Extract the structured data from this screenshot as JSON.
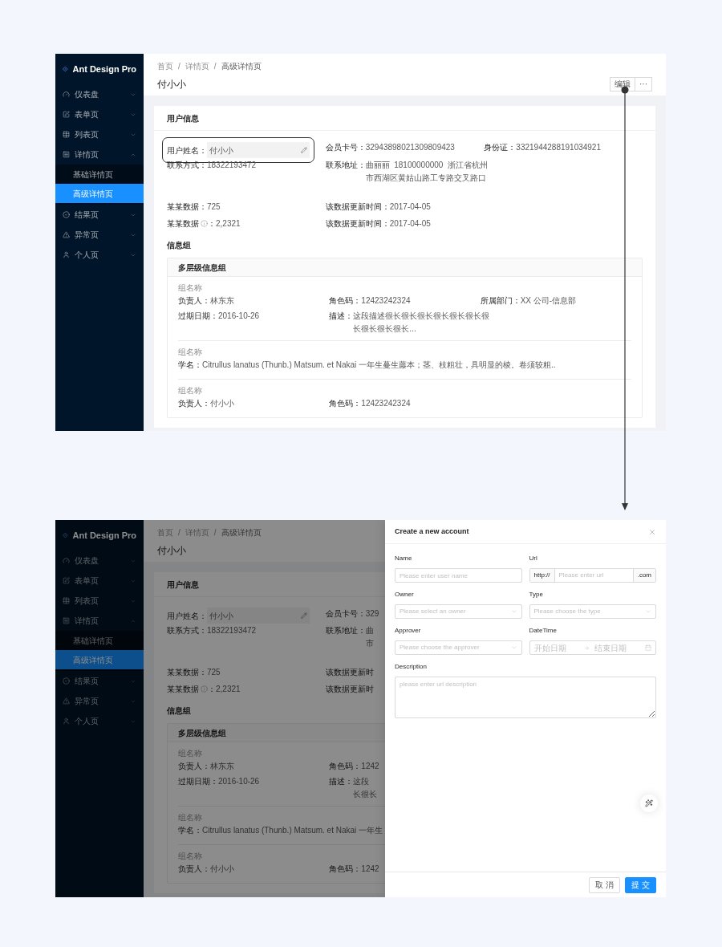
{
  "screens": [
    {
      "dimmed": false,
      "sidebar": {
        "logo": "Ant Design Pro",
        "items": [
          {
            "label": "仪表盘",
            "expanded": false,
            "selected": false
          },
          {
            "label": "表单页",
            "expanded": false,
            "selected": false
          },
          {
            "label": "列表页",
            "expanded": false,
            "selected": false
          },
          {
            "label": "详情页",
            "expanded": true,
            "selected": false,
            "children": [
              {
                "label": "基础详情页",
                "selected": false
              },
              {
                "label": "高级详情页",
                "selected": true
              }
            ]
          },
          {
            "label": "结果页",
            "expanded": false,
            "selected": false
          },
          {
            "label": "异常页",
            "expanded": false,
            "selected": false
          },
          {
            "label": "个人页",
            "expanded": false,
            "selected": false
          }
        ]
      },
      "header": {
        "breadcrumb": [
          "首页",
          "详情页",
          "高级详情页"
        ],
        "separator": "/",
        "title": "付小小",
        "actions": [
          "编辑",
          "···"
        ]
      },
      "card": {
        "title": "用户信息",
        "sections": [
          {
            "rows": [
              [
                {
                  "kind": "editable",
                  "label": "用户姓名：",
                  "value": "付小小",
                  "highlighted": true
                },
                {
                  "kind": "text",
                  "label": "会员卡号：",
                  "value": "32943898021309809423"
                },
                {
                  "kind": "text",
                  "label": "身份证：",
                  "value": "3321944288191034921"
                }
              ],
              [
                {
                  "kind": "text",
                  "label": "联系方式：",
                  "value": "18322193472"
                },
                {
                  "kind": "lines",
                  "label": "联系地址：",
                  "lines": [
                    "曲丽丽  18100000000  浙江省杭州",
                    "市西湖区黄姑山路工专路交叉路口"
                  ]
                }
              ]
            ]
          },
          {
            "rows": [
              [
                {
                  "kind": "text",
                  "label": "某某数据：",
                  "value": "725"
                },
                {
                  "kind": "text",
                  "label": "该数据更新时间：",
                  "value": "2017-04-05"
                }
              ],
              [
                {
                  "kind": "info",
                  "label": "某某数据",
                  "colon": "：",
                  "value": "2,2321"
                },
                {
                  "kind": "text",
                  "label": "该数据更新时间：",
                  "value": "2017-04-05"
                }
              ]
            ]
          }
        ],
        "group_title": "信息组",
        "group": {
          "title": "多层级信息组",
          "subgroups": [
            {
              "title": "组名称",
              "rows": [
                [
                  {
                    "kind": "text",
                    "label": "负责人：",
                    "value": "林东东"
                  },
                  {
                    "kind": "text",
                    "label": "角色码：",
                    "value": "12423242324"
                  },
                  {
                    "kind": "text",
                    "label": "所属部门：",
                    "value": "XX 公司-信息部"
                  }
                ],
                [
                  {
                    "kind": "text",
                    "label": "过期日期：",
                    "value": "2016-10-26"
                  },
                  {
                    "kind": "lines",
                    "label": "描述：",
                    "lines": [
                      "这段描述很长很长很长很长很长很长很",
                      "长很长很长很长..."
                    ]
                  }
                ]
              ]
            },
            {
              "title": "组名称",
              "rows": [
                [
                  {
                    "kind": "text",
                    "label": "学名：",
                    "value": "Citrullus lanatus (Thunb.) Matsum. et Nakai 一年生蔓生藤本；茎、枝粗壮，具明显的棱。卷须较粗.."
                  }
                ]
              ]
            },
            {
              "title": "组名称",
              "rows": [
                [
                  {
                    "kind": "text",
                    "label": "负责人：",
                    "value": "付小小"
                  },
                  {
                    "kind": "text",
                    "label": "角色码：",
                    "value": "12423242324"
                  }
                ]
              ]
            }
          ]
        }
      }
    },
    {
      "dimmed": true,
      "sidebar": {
        "logo": "Ant Design Pro",
        "items": [
          {
            "label": "仪表盘",
            "expanded": false,
            "selected": false
          },
          {
            "label": "表单页",
            "expanded": false,
            "selected": false
          },
          {
            "label": "列表页",
            "expanded": false,
            "selected": false
          },
          {
            "label": "详情页",
            "expanded": true,
            "selected": false,
            "children": [
              {
                "label": "基础详情页",
                "selected": false
              },
              {
                "label": "高级详情页",
                "selected": true
              }
            ]
          },
          {
            "label": "结果页",
            "expanded": false,
            "selected": false
          },
          {
            "label": "异常页",
            "expanded": false,
            "selected": false
          },
          {
            "label": "个人页",
            "expanded": false,
            "selected": false
          }
        ]
      },
      "header": {
        "breadcrumb": [
          "首页",
          "详情页",
          "高级详情页"
        ],
        "separator": "/",
        "title": "付小小"
      },
      "card": {
        "title": "用户信息",
        "sections": [
          {
            "rows": [
              [
                {
                  "kind": "editable",
                  "label": "用户姓名：",
                  "value": "付小小",
                  "highlighted": false
                },
                {
                  "kind": "text",
                  "label": "会员卡号：",
                  "value": "329"
                }
              ],
              [
                {
                  "kind": "text",
                  "label": "联系方式：",
                  "value": "18322193472"
                },
                {
                  "kind": "lines",
                  "label": "联系地址：",
                  "lines": [
                    "曲",
                    "市"
                  ]
                }
              ]
            ]
          },
          {
            "rows": [
              [
                {
                  "kind": "text",
                  "label": "某某数据：",
                  "value": "725"
                },
                {
                  "kind": "text",
                  "label": "该数据更新时"
                }
              ],
              [
                {
                  "kind": "info",
                  "label": "某某数据",
                  "colon": "：",
                  "value": "2,2321"
                },
                {
                  "kind": "text",
                  "label": "该数据更新时"
                }
              ]
            ]
          }
        ],
        "group_title": "信息组",
        "group": {
          "title": "多层级信息组",
          "subgroups": [
            {
              "title": "组名称",
              "rows": [
                [
                  {
                    "kind": "text",
                    "label": "负责人：",
                    "value": "林东东"
                  },
                  {
                    "kind": "text",
                    "label": "角色码：",
                    "value": "1242"
                  }
                ],
                [
                  {
                    "kind": "text",
                    "label": "过期日期：",
                    "value": "2016-10-26"
                  },
                  {
                    "kind": "lines",
                    "label": "描述：",
                    "lines": [
                      "这段",
                      "长很长"
                    ]
                  }
                ]
              ]
            },
            {
              "title": "组名称",
              "rows": [
                [
                  {
                    "kind": "text",
                    "label": "学名：",
                    "value": "Citrullus lanatus (Thunb.) Matsum. et Nakai 一年生"
                  }
                ]
              ]
            },
            {
              "title": "组名称",
              "rows": [
                [
                  {
                    "kind": "text",
                    "label": "负责人：",
                    "value": "付小小"
                  },
                  {
                    "kind": "text",
                    "label": "角色码：",
                    "value": "1242"
                  }
                ]
              ]
            }
          ]
        }
      },
      "drawer": {
        "title": "Create a new account",
        "rows": [
          [
            {
              "kind": "input",
              "label": "Name",
              "placeholder": "Please enter user name"
            },
            {
              "kind": "addon",
              "label": "Url",
              "prefix": "http://",
              "placeholder": "Please enter url",
              "suffix": ".com"
            }
          ],
          [
            {
              "kind": "select",
              "label": "Owner",
              "placeholder": "Please select an owner"
            },
            {
              "kind": "select",
              "label": "Type",
              "placeholder": "Please choose the type"
            }
          ],
          [
            {
              "kind": "select",
              "label": "Approver",
              "placeholder": "Please choose the approver"
            },
            {
              "kind": "range",
              "label": "DateTime",
              "start_placeholder": "开始日期",
              "end_placeholder": "结束日期"
            }
          ],
          [
            {
              "kind": "textarea",
              "label": "Description",
              "placeholder": "please enter url description"
            }
          ]
        ],
        "buttons": [
          {
            "kind": "default",
            "label": "取 消"
          },
          {
            "kind": "primary",
            "label": "提 交"
          }
        ]
      }
    }
  ]
}
